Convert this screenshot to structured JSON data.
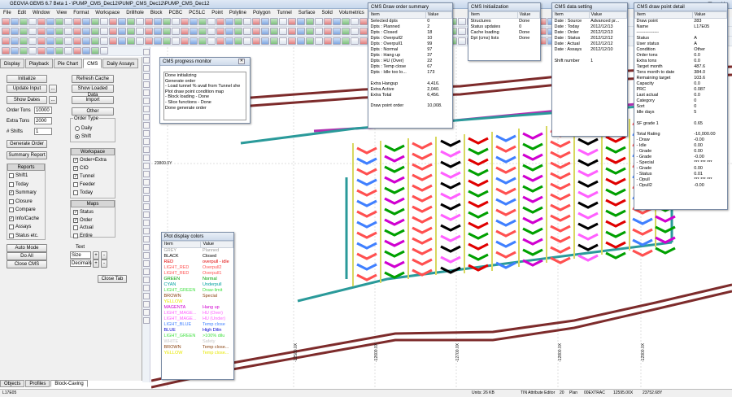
{
  "app": {
    "title": "GEOVIA GEMS 6.7 Beta 1 - \\PUMP_CMS_Dec12\\PUMP_CMS_Dec12\\PUMP_CMS_Dec12"
  },
  "menu": [
    "File",
    "Edit",
    "Window",
    "View",
    "Format",
    "Workspace",
    "Drillhole",
    "Block",
    "PCBC",
    "PCSLC",
    "Point",
    "Polyline",
    "Polygon",
    "Tunnel",
    "Surface",
    "Solid",
    "Volumetrics",
    "Tools",
    "Options"
  ],
  "left_tabs": [
    "Display",
    "Playback",
    "Pie Chart",
    "CMS",
    "Daily Assays"
  ],
  "cms": {
    "initialize": "Initialize",
    "refresh_cache": "Refresh Cache",
    "update_input": "Update Input",
    "ellipsis": "...",
    "show_loaded_data": "Show Loaded Data",
    "show_dates": "Show Dates",
    "import": "Import",
    "other": "Other",
    "order_tons_label": "Order Tons",
    "order_tons": "10000",
    "extra_tons_label": "Extra Tons",
    "extra_tons": "2000",
    "shifts_label": "# Shifts",
    "shifts": "1",
    "order_type": "Order Type",
    "daily": "Daily",
    "shift": "Shift",
    "generate_order": "Generate Order",
    "summary_report": "Summary Report",
    "reports_title": "Reports",
    "reports": [
      "Shift1",
      "Today",
      "Summary",
      "Closure",
      "Compare",
      "Info/Cache",
      "Assays",
      "Status etc."
    ],
    "workspace_title": "Workspace",
    "workspace": [
      "Order+Extra",
      "CIO",
      "Tunnel",
      "Feeder",
      "Today"
    ],
    "maps_title": "Maps",
    "maps": [
      "Status",
      "Order",
      "Actual",
      "Entire"
    ],
    "auto_mode": "Auto Mode",
    "do_all": "Do All",
    "close_cms": "Close CMS",
    "text_title": "Text",
    "size": "Size",
    "decimals": "Decimals",
    "plus": "+",
    "minus": "-",
    "close_tab": "Close Tab"
  },
  "bottom_tabs": [
    "Objects",
    "Profiles",
    "Block-Caving"
  ],
  "status": {
    "coord": "L17E05",
    "units": "Units: 26 KB",
    "tin": "TIN Attribute Editor",
    "zoom": "20",
    "plan": "Plan",
    "mode": "00EXTRAC",
    "x": "12595.00X",
    "y": "23752.68Y"
  },
  "progress": {
    "title": "CMS progress monitor",
    "lines": [
      "Done initializing",
      "Generate order",
      "- Load tunnel % avail from Tunnel she",
      "Plot draw point condition map",
      "- Block loading - Done",
      "- Slice functions - Done",
      "Done generate order"
    ]
  },
  "order_summary": {
    "title": "CMS Draw order summary",
    "head": [
      "Item",
      "Value"
    ],
    "rows": [
      [
        "Selected dpts",
        "0"
      ],
      [
        "Dpts : Planned",
        "2"
      ],
      [
        "Dpts : Closed",
        "18"
      ],
      [
        "Dpts : Overpull2",
        "10"
      ],
      [
        "Dpts : Overpull1",
        "99"
      ],
      [
        "Dpts : Normal",
        "97"
      ],
      [
        "Dpts : Hang up",
        "37"
      ],
      [
        "Dpts : HU (Over)",
        "22"
      ],
      [
        "Dpts : Temp close",
        "67"
      ],
      [
        "Dpts : Idle too lo...",
        "173"
      ],
      [
        "",
        ""
      ],
      [
        "Extra Hangup",
        "4,416."
      ],
      [
        "Extra Active",
        "2,040."
      ],
      [
        "Extra Total",
        "6,456."
      ],
      [
        "",
        ""
      ],
      [
        "Draw point order",
        "10,008."
      ]
    ]
  },
  "init_win": {
    "title": "CMS Initialization",
    "head": [
      "Item",
      "Value"
    ],
    "rows": [
      [
        "Structures",
        "Done"
      ],
      [
        "Status updates",
        "0"
      ],
      [
        "Cache loading",
        "Done"
      ],
      [
        "Dpt (cms) lists",
        "Done"
      ]
    ]
  },
  "data_setting": {
    "title": "CMS data setting",
    "head": [
      "Item",
      "Value"
    ],
    "rows": [
      [
        "Date : Source",
        "Advanced pr..."
      ],
      [
        "Date : Today",
        "2012/12/13"
      ],
      [
        "Date : Order",
        "2012/12/13"
      ],
      [
        "Date : Status",
        "2012/12/12"
      ],
      [
        "Date : Actual",
        "2012/12/12"
      ],
      [
        "Date : Assays",
        "2012/12/10"
      ],
      [
        "",
        ""
      ],
      [
        "Shift number",
        "1"
      ]
    ]
  },
  "detail": {
    "title": "CMS draw point detail",
    "head": [
      "Item",
      "Value"
    ],
    "rows": [
      [
        "Draw point",
        "283"
      ],
      [
        "Name",
        "L17E05"
      ],
      [
        "---------------",
        ""
      ],
      [
        "Status",
        "A"
      ],
      [
        "User status",
        "A"
      ],
      [
        "Condition",
        "Other"
      ],
      [
        "Order tons",
        "0.0"
      ],
      [
        "Extra tons",
        "0.0"
      ],
      [
        "Target month",
        "487.6"
      ],
      [
        "Tons month to date",
        "384.0"
      ],
      [
        "Remaining target",
        "103.6"
      ],
      [
        "Capacity",
        "0.0"
      ],
      [
        "PRC",
        "0.087"
      ],
      [
        "Last actual",
        "0.0"
      ],
      [
        "Category",
        "0"
      ],
      [
        "Sort",
        "0"
      ],
      [
        "Idle days",
        "5"
      ],
      [
        "",
        ""
      ],
      [
        "SF grade 1",
        "0.65"
      ],
      [
        "",
        ""
      ],
      [
        "Total Rating",
        "-10,000.00"
      ],
      [
        " - Draw",
        "-0.00"
      ],
      [
        " - Idle",
        "0.00"
      ],
      [
        " - Grade",
        "0.00"
      ],
      [
        " - Grade",
        "-0.00"
      ],
      [
        " - Special",
        "*** *** ***"
      ],
      [
        " - Grade",
        "0.00"
      ],
      [
        " - Status",
        "0.01"
      ],
      [
        " - Opull",
        "*** *** ***"
      ],
      [
        " - Opull2",
        "-0.00"
      ]
    ]
  },
  "plot_colors": {
    "title": "Plot display colors",
    "head": [
      "Item",
      "Value"
    ],
    "rows": [
      {
        "item": "GREY",
        "value": "Planned",
        "color": "#9a9a9a"
      },
      {
        "item": "BLACK",
        "value": "Closed",
        "color": "#000000"
      },
      {
        "item": "RED",
        "value": "overpull - idle",
        "color": "#e00000"
      },
      {
        "item": "LIGHT_RED",
        "value": "Overpull2",
        "color": "#ff5050"
      },
      {
        "item": "LIGHT_RED",
        "value": "Overpull1",
        "color": "#ff5050"
      },
      {
        "item": "GREEN",
        "value": "Normal",
        "color": "#00a000"
      },
      {
        "item": "CYAN",
        "value": "Underpull",
        "color": "#00a0a0"
      },
      {
        "item": "LIGHT_GREEN",
        "value": "Draw-limit",
        "color": "#40e040"
      },
      {
        "item": "BROWN",
        "value": "Special",
        "color": "#8b4513"
      },
      {
        "item": "YELLOW",
        "value": "",
        "color": "#e8e800"
      },
      {
        "item": "MAGENTA",
        "value": "Hang up",
        "color": "#d000d0"
      },
      {
        "item": "LIGHT_MAGE...",
        "value": "HU (Over)",
        "color": "#ff60ff"
      },
      {
        "item": "LIGHT_MAGE...",
        "value": "HU (Under)",
        "color": "#ff60ff"
      },
      {
        "item": "LIGHT_BLUE",
        "value": "Temp close",
        "color": "#4080ff"
      },
      {
        "item": "BLUE",
        "value": "High Dilin",
        "color": "#0000d0"
      },
      {
        "item": "LIGHT_GREEN",
        "value": ">100% dilu",
        "color": "#40e040"
      },
      {
        "item": "WHITE",
        "value": "Safety",
        "color": "#c8c8c8"
      },
      {
        "item": "BROWN",
        "value": "Temp close...",
        "color": "#8b4513"
      },
      {
        "item": "YELLOW",
        "value": "Temp close...",
        "color": "#e8e800"
      }
    ]
  },
  "grid_labels": {
    "y1": "23800.0Y",
    "x_labels": [
      "-12400.0X",
      "-12500.0X",
      "-12600.0X",
      "-12700.0X",
      "-12800.0X",
      "-12900.0X"
    ]
  }
}
